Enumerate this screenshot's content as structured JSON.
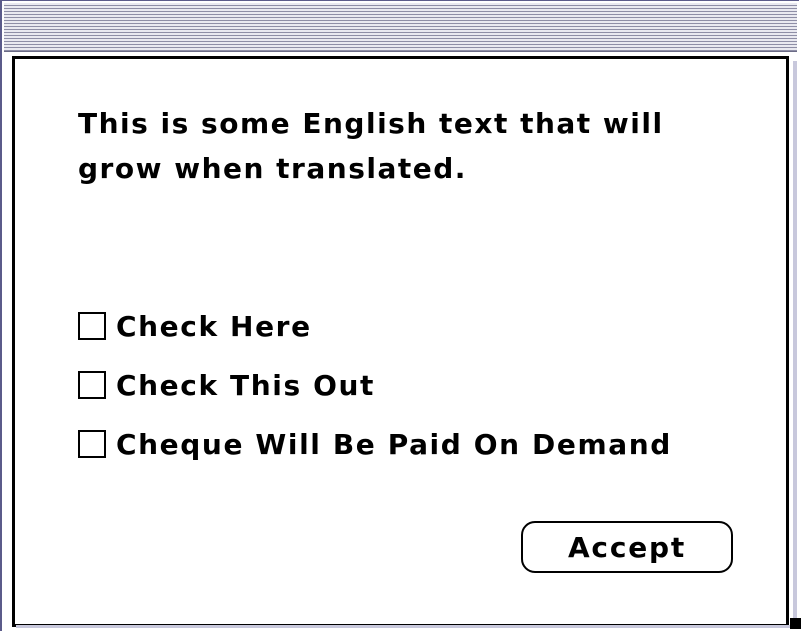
{
  "dialog": {
    "message": "This is some English text that will\ngrow when translated.",
    "checkboxes": [
      {
        "label": "Check Here",
        "checked": false
      },
      {
        "label": "Check This Out",
        "checked": false
      },
      {
        "label": "Cheque Will Be Paid On Demand",
        "checked": false
      }
    ],
    "accept_label": "Accept"
  },
  "colors": {
    "title_stripe_light": "#e9e9f0",
    "title_stripe_dark": "#8e8ea6",
    "frame": "#5b5b8a",
    "text": "#000000",
    "background": "#ffffff"
  }
}
